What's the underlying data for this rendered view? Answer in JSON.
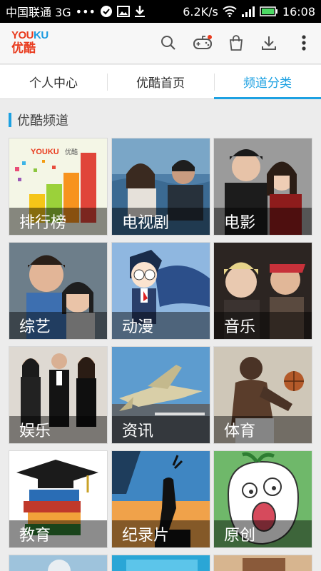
{
  "status_bar": {
    "carrier": "中国联通 3G",
    "dots": "•••",
    "speed": "6.2K/s",
    "time": "16:08"
  },
  "app": {
    "logo_en_a": "YOU",
    "logo_en_b": "KU",
    "logo_cn": "优酷",
    "icons": [
      "search-icon",
      "gamepad-icon",
      "shopping-bag-icon",
      "download-icon",
      "more-icon"
    ]
  },
  "tabs": [
    {
      "label": "个人中心",
      "active": false
    },
    {
      "label": "优酷首页",
      "active": false
    },
    {
      "label": "频道分类",
      "active": true
    }
  ],
  "section": {
    "title": "优酷频道"
  },
  "channels": [
    {
      "label": "排行榜"
    },
    {
      "label": "电视剧"
    },
    {
      "label": "电影"
    },
    {
      "label": "综艺"
    },
    {
      "label": "动漫"
    },
    {
      "label": "音乐"
    },
    {
      "label": "娱乐"
    },
    {
      "label": "资讯"
    },
    {
      "label": "体育"
    },
    {
      "label": "教育"
    },
    {
      "label": "纪录片"
    },
    {
      "label": "原创"
    }
  ],
  "colors": {
    "accent": "#1da1e2",
    "brand_red": "#e93b1e"
  }
}
